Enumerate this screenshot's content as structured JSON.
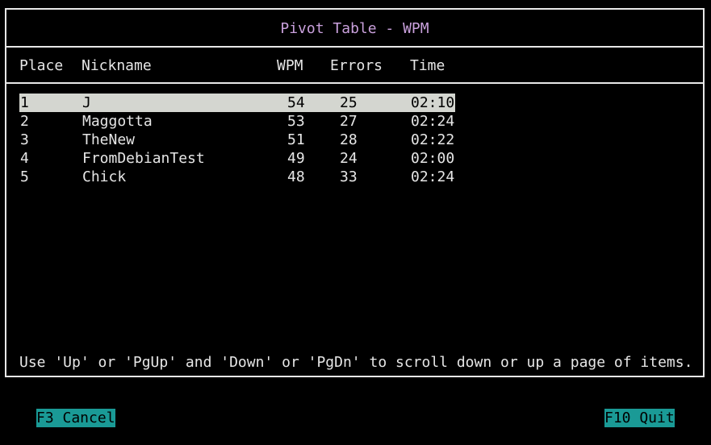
{
  "dialog": {
    "title": "Pivot Table - WPM",
    "columns": {
      "place": "Place",
      "nickname": "Nickname",
      "wpm": "WPM",
      "errors": "Errors",
      "time": "Time"
    },
    "rows": [
      {
        "place": "1",
        "nickname": "J",
        "wpm": "54",
        "errors": "25",
        "time": "02:10",
        "selected": true
      },
      {
        "place": "2",
        "nickname": "Maggotta",
        "wpm": "53",
        "errors": "27",
        "time": "02:24",
        "selected": false
      },
      {
        "place": "3",
        "nickname": "TheNew",
        "wpm": "51",
        "errors": "28",
        "time": "02:22",
        "selected": false
      },
      {
        "place": "4",
        "nickname": "FromDebianTest",
        "wpm": "49",
        "errors": "24",
        "time": "02:00",
        "selected": false
      },
      {
        "place": "5",
        "nickname": "Chick",
        "wpm": "48",
        "errors": "33",
        "time": "02:24",
        "selected": false
      }
    ],
    "hint": "Use 'Up' or 'PgUp' and 'Down' or 'PgDn' to scroll down or up a page of items."
  },
  "function_keys": {
    "cancel": "F3 Cancel",
    "quit": "F10 Quit"
  },
  "colors": {
    "background": "#000000",
    "border": "#e8e8e8",
    "title": "#c9a0dc",
    "selection": "#d4d6d0",
    "function_key_bg": "#1a9a96"
  }
}
